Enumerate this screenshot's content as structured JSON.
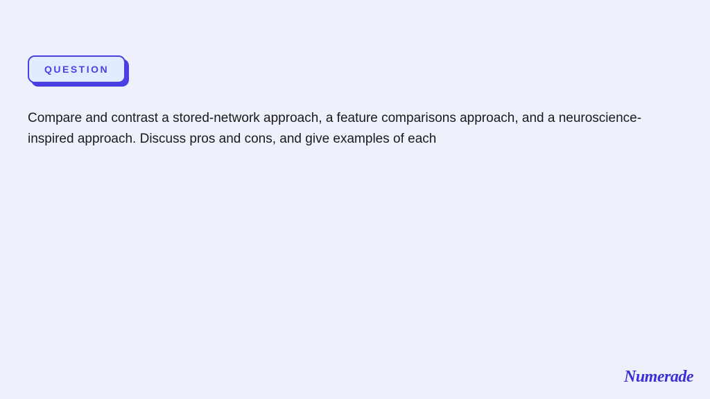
{
  "badge": {
    "label": "QUESTION"
  },
  "question": {
    "text": "Compare and contrast a stored-network approach, a feature comparisons approach, and a neuroscience-inspired approach. Discuss pros and cons, and give examples of each"
  },
  "brand": {
    "name": "Numerade"
  }
}
